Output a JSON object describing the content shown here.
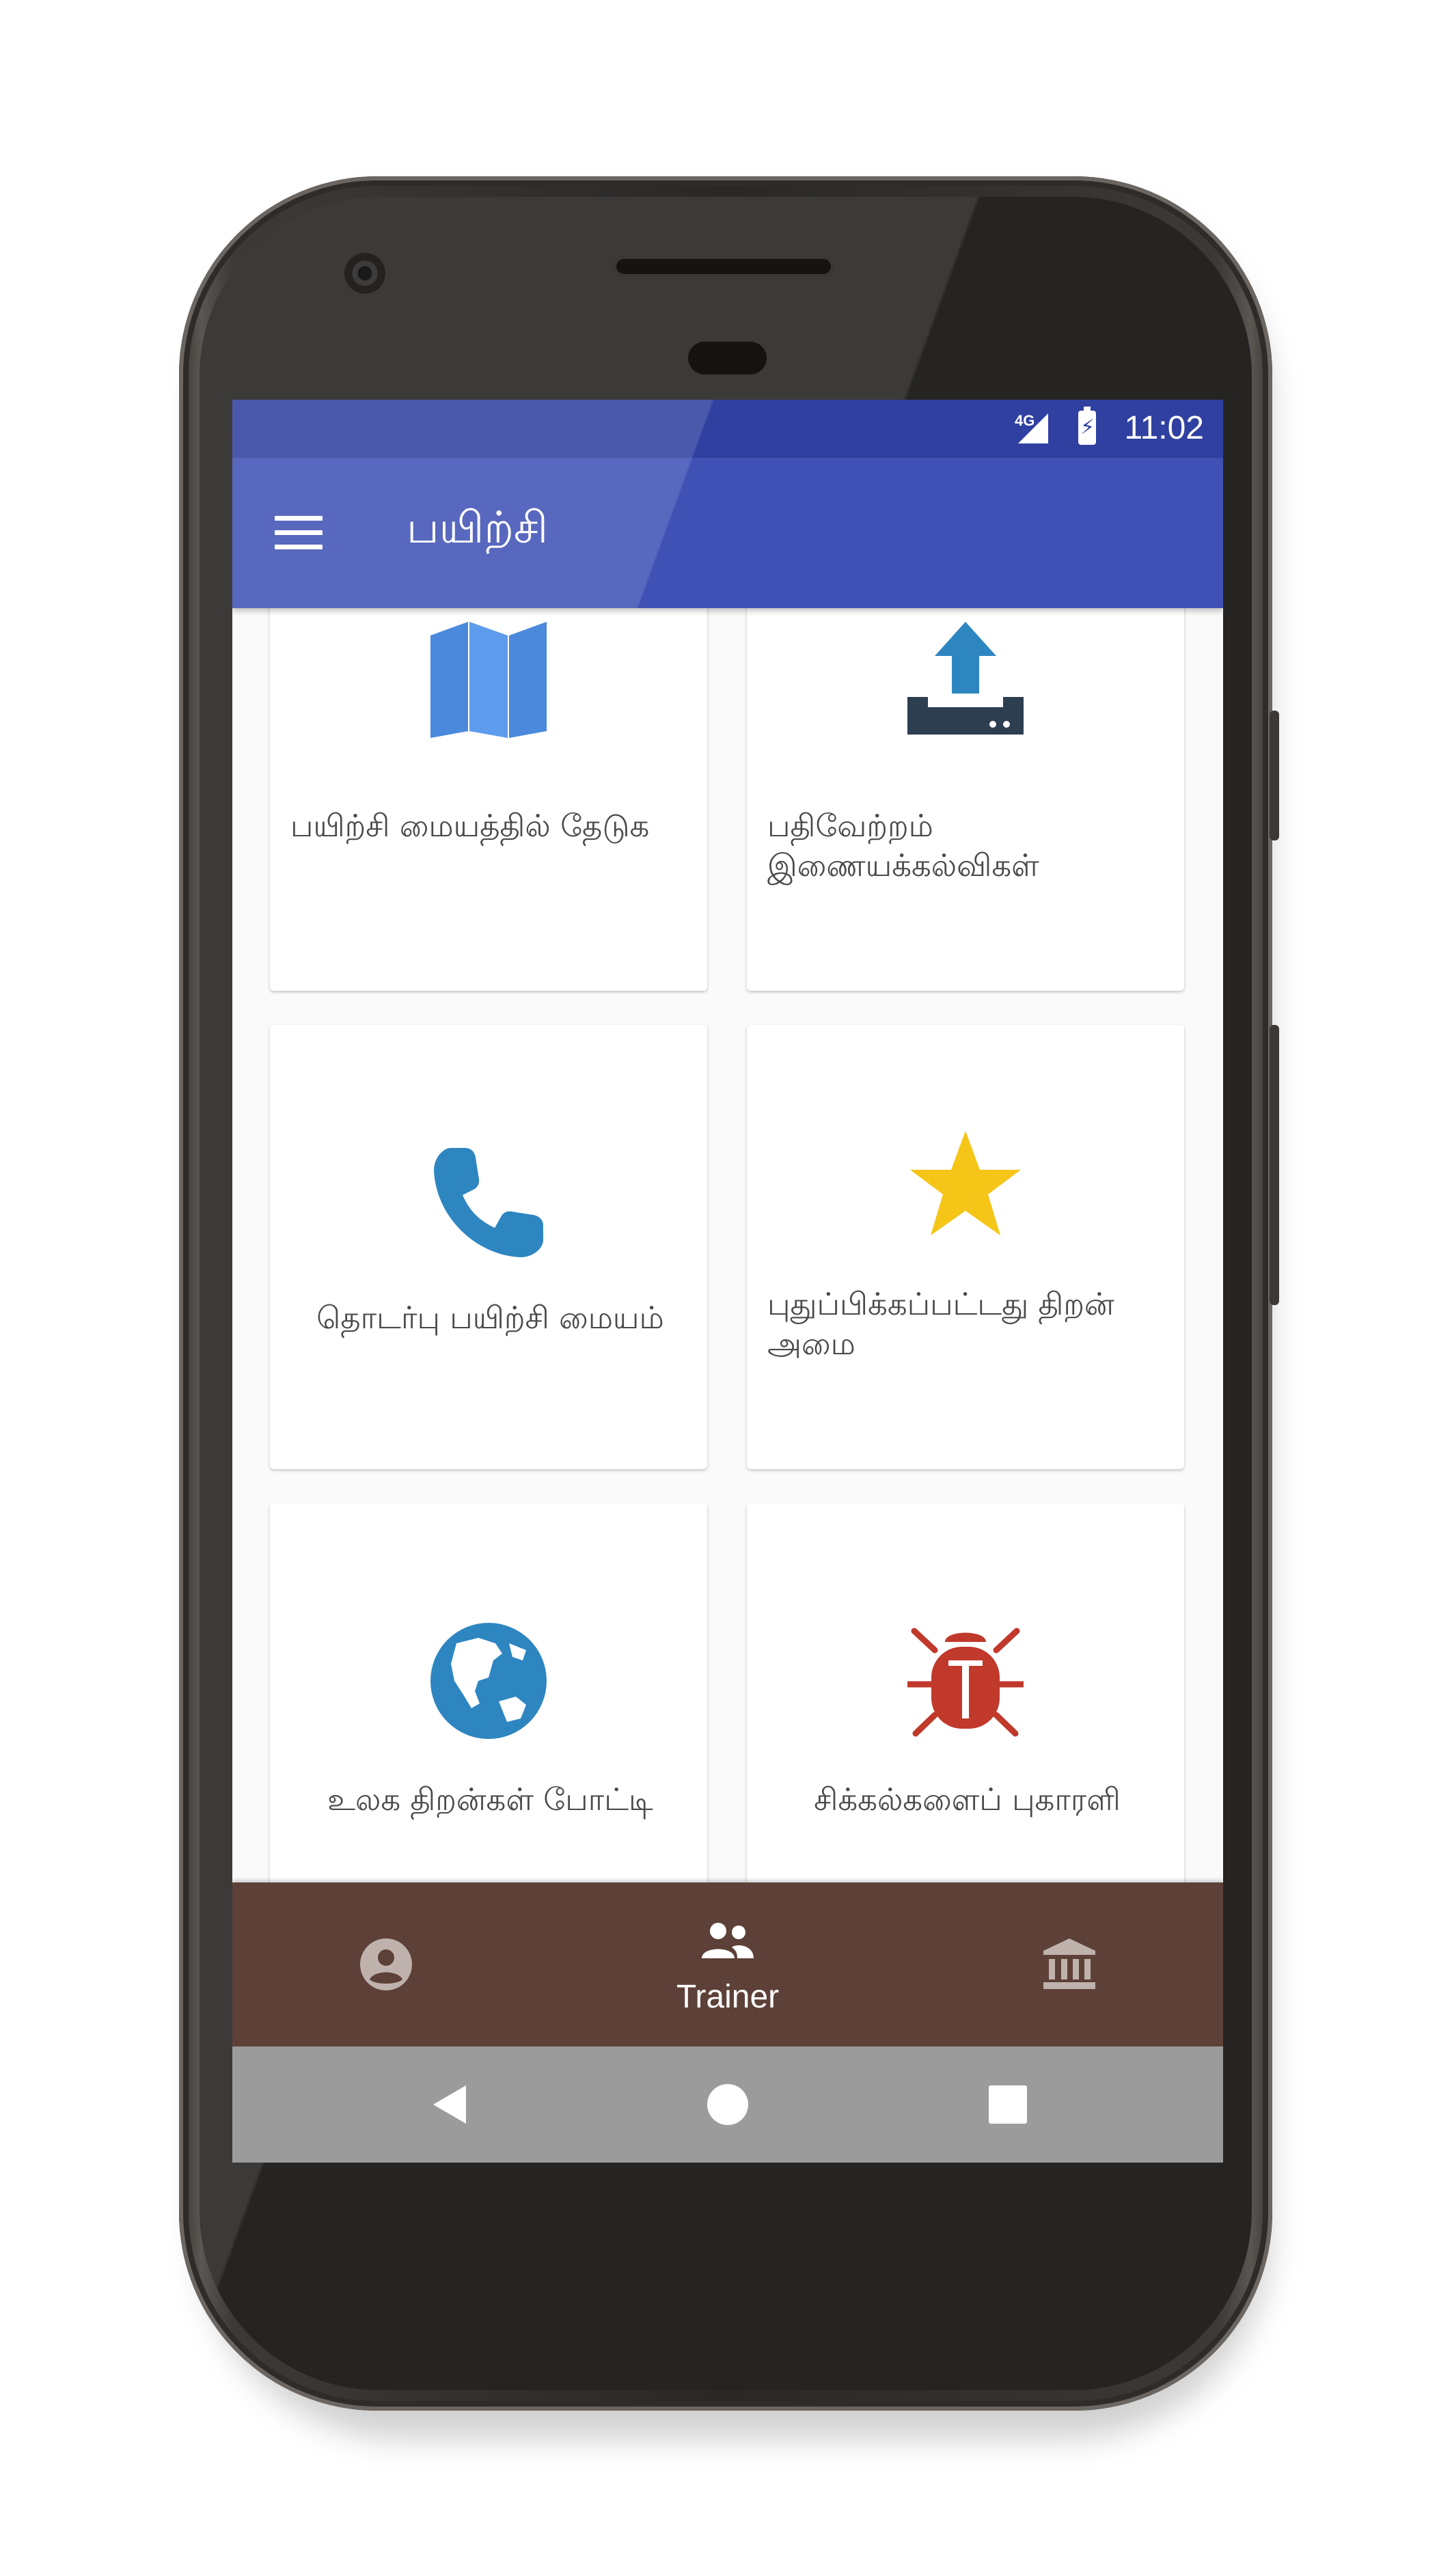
{
  "status_bar": {
    "network": "4G",
    "time": "11:02"
  },
  "app_bar": {
    "title": "பயிற்சி",
    "menu_icon": "hamburger-menu-icon"
  },
  "cards": [
    {
      "label": "பயிற்சி மையத்தில் தேடுக",
      "icon": "map-icon",
      "color": "#4a89dc"
    },
    {
      "label": "பதிவேற்றம் இணையக்கல்விகள்",
      "icon": "upload-tray-icon",
      "color": "#2e86c1"
    },
    {
      "label": "தொடர்பு பயிற்சி மையம்",
      "icon": "phone-icon",
      "color": "#2e86c1"
    },
    {
      "label": "புதுப்பிக்கப்பட்டது திறன் அமை",
      "icon": "star-icon",
      "color": "#f5c518"
    },
    {
      "label": "உலக திறன்கள் போட்டி",
      "icon": "globe-icon",
      "color": "#2e86c1"
    },
    {
      "label": "சிக்கல்களைப் புகாரளி",
      "icon": "bug-icon",
      "color": "#c0392b"
    }
  ],
  "bottom_nav": {
    "items": [
      {
        "icon": "account-circle-icon",
        "label": ""
      },
      {
        "icon": "people-icon",
        "label": "Trainer"
      },
      {
        "icon": "bank-icon",
        "label": ""
      }
    ],
    "background": "#5d4037"
  },
  "system_nav": {
    "buttons": [
      "back-icon",
      "home-icon",
      "recents-icon"
    ]
  },
  "colors": {
    "primary": "#3f51b5",
    "status_bar": "#3040a0"
  }
}
